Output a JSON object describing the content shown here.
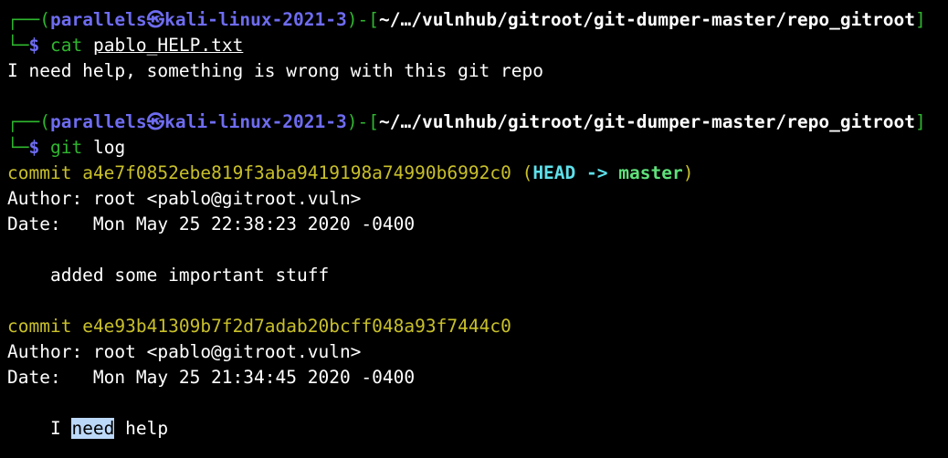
{
  "prompt1": {
    "corner_top": "┌──",
    "corner_bottom": "└─",
    "open_paren": "(",
    "user": "parallels",
    "at_symbol": "㉿",
    "host": "kali-linux-2021-3",
    "close_paren": ")",
    "dash": "-",
    "open_bracket": "[",
    "path": "~/…/vulnhub/gitroot/git-dumper-master/repo_gitroot",
    "close_bracket": "]",
    "dollar": "$",
    "command": "cat",
    "argument": "pablo_HELP.txt"
  },
  "output1": "I need help, something is wrong with this git repo",
  "prompt2": {
    "corner_top": "┌──",
    "corner_bottom": "└─",
    "open_paren": "(",
    "user": "parallels",
    "at_symbol": "㉿",
    "host": "kali-linux-2021-3",
    "close_paren": ")",
    "dash": "-",
    "open_bracket": "[",
    "path": "~/…/vulnhub/gitroot/git-dumper-master/repo_gitroot",
    "close_bracket": "]",
    "dollar": "$",
    "command": "git",
    "argument": "log"
  },
  "commits": [
    {
      "commit_label": "commit",
      "hash": "a4e7f0852ebe819f3aba9419198a74990b6992c0",
      "ref_open": "(",
      "head": "HEAD",
      "arrow": "->",
      "branch": "master",
      "ref_close": ")",
      "author": "Author: root <pablo@gitroot.vuln>",
      "date": "Date:   Mon May 25 22:38:23 2020 -0400",
      "message": "    added some important stuff"
    },
    {
      "commit_label": "commit",
      "hash": "e4e93b41309b7f2d7adab20bcff048a93f7444c0",
      "author": "Author: root <pablo@gitroot.vuln>",
      "date": "Date:   Mon May 25 21:34:45 2020 -0400",
      "message_prefix": "    I ",
      "message_highlight": "need",
      "message_suffix": " help"
    }
  ],
  "colors": {
    "background": "#000000",
    "prompt_box": "#2fb62f",
    "prompt_user": "#6e6cf0",
    "commit_yellow": "#c9c02a",
    "head_cyan": "#5ee0ea",
    "branch_green": "#5fe07a",
    "selection": "#bcd8f8"
  }
}
